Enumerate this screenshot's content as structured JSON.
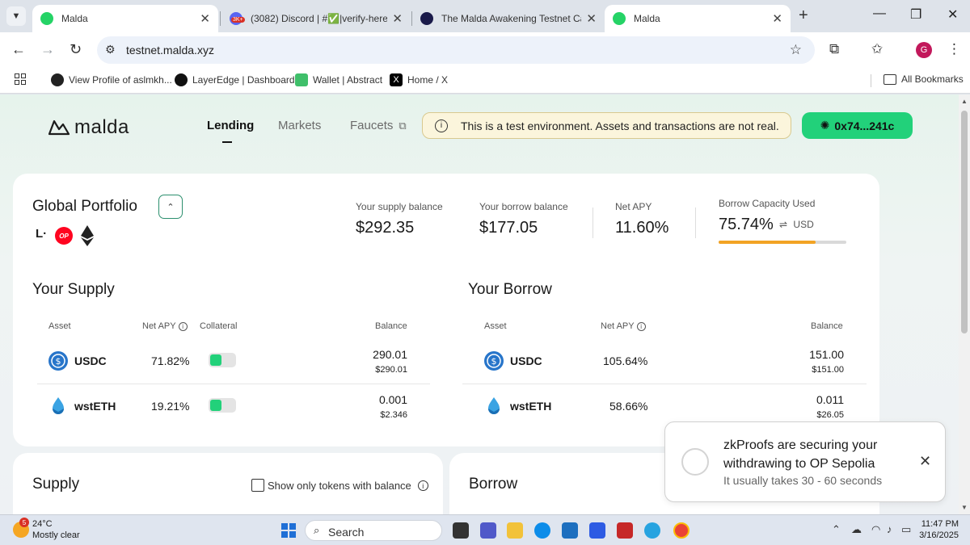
{
  "browser": {
    "tabs": [
      {
        "title": "Malda",
        "active": true
      },
      {
        "title": "(3082) Discord | #✅|verify-here |",
        "active": false
      },
      {
        "title": "The Malda Awakening Testnet Car",
        "active": false
      },
      {
        "title": "Malda",
        "active": true
      }
    ],
    "url": "testnet.malda.xyz",
    "profile_initial": "G",
    "discord_badge": "3K+",
    "bookmarks": [
      {
        "label": "View Profile of aslmkh..."
      },
      {
        "label": "LayerEdge | Dashboard"
      },
      {
        "label": "Wallet | Abstract"
      },
      {
        "label": "Home / X"
      }
    ],
    "all_bookmarks": "All Bookmarks"
  },
  "app": {
    "logo_text": "malda",
    "nav": [
      {
        "label": "Lending"
      },
      {
        "label": "Markets"
      },
      {
        "label": "Faucets"
      }
    ],
    "banner": "This is a test environment. Assets and transactions are not real.",
    "wallet": "0x74...241c"
  },
  "portfolio": {
    "title": "Global Portfolio",
    "chain_op": "OP",
    "supply_label": "Your supply balance",
    "supply_value": "$292.35",
    "borrow_label": "Your borrow balance",
    "borrow_value": "$177.05",
    "apy_label": "Net APY",
    "apy_value": "11.60%",
    "capacity_label": "Borrow Capacity Used",
    "capacity_value": "75.74%",
    "capacity_fraction": 0.7574,
    "capacity_unit": "USD",
    "capacity_color": "#f2a324"
  },
  "your_supply": {
    "title": "Your Supply",
    "headers": {
      "asset": "Asset",
      "apy": "Net APY",
      "collateral": "Collateral",
      "balance": "Balance"
    },
    "rows": [
      {
        "asset": "USDC",
        "apy": "71.82%",
        "balance": "290.01",
        "balance_usd": "$290.01",
        "collateral": true
      },
      {
        "asset": "wstETH",
        "apy": "19.21%",
        "balance": "0.001",
        "balance_usd": "$2.346",
        "collateral": true
      }
    ]
  },
  "your_borrow": {
    "title": "Your Borrow",
    "headers": {
      "asset": "Asset",
      "apy": "Net APY",
      "balance": "Balance"
    },
    "rows": [
      {
        "asset": "USDC",
        "apy": "105.64%",
        "balance": "151.00",
        "balance_usd": "$151.00"
      },
      {
        "asset": "wstETH",
        "apy": "58.66%",
        "balance": "0.011",
        "balance_usd": "$26.05"
      }
    ]
  },
  "supply_card": {
    "title": "Supply",
    "checkbox_label": "Show only tokens with balance"
  },
  "borrow_card": {
    "title": "Borrow"
  },
  "toast": {
    "title": "zkProofs are securing your withdrawing to OP Sepolia",
    "subtitle": "It usually takes 30 - 60 seconds"
  },
  "taskbar": {
    "weather_badge": "5",
    "temperature": "24°C",
    "condition": "Mostly clear",
    "search": "Search",
    "time": "11:47 PM",
    "date": "3/16/2025"
  },
  "colors": {
    "accent": "#22d17a",
    "brand_border": "#2c8f6e"
  }
}
